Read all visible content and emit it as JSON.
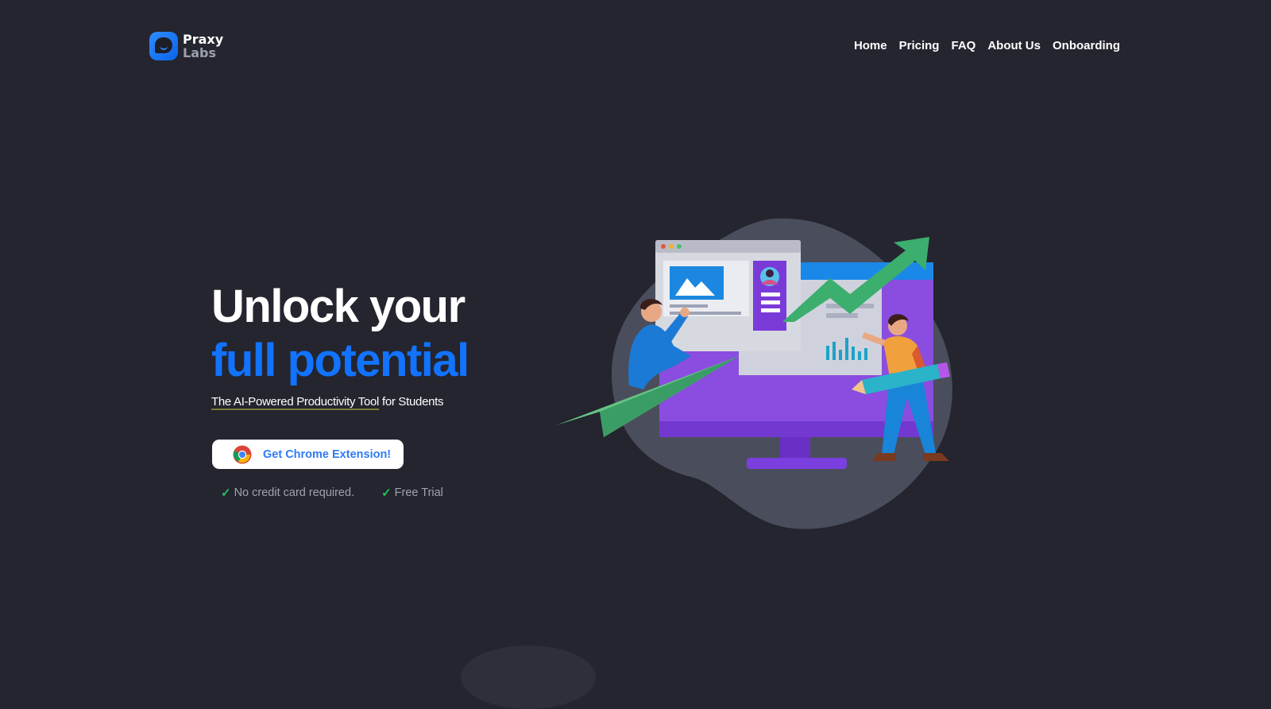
{
  "brand": {
    "line1": "Praxy",
    "line2": "Labs"
  },
  "nav": {
    "items": [
      {
        "label": "Home"
      },
      {
        "label": "Pricing"
      },
      {
        "label": "FAQ"
      },
      {
        "label": "About Us"
      },
      {
        "label": "Onboarding"
      }
    ]
  },
  "hero": {
    "title_line1": "Unlock your",
    "title_line2": "full potential",
    "subtitle_highlight": "The AI-Powered Productivity Tool",
    "subtitle_rest": " for Students",
    "cta_label": "Get Chrome Extension!",
    "checks": [
      {
        "label": "No credit card required."
      },
      {
        "label": "Free Trial"
      }
    ]
  },
  "icons": {
    "logo": "chat-bubble-logo-icon",
    "cta": "chrome-icon",
    "check": "checkmark-icon"
  },
  "colors": {
    "background": "#24252f",
    "accent": "#1273ff",
    "check": "#22c55e"
  }
}
